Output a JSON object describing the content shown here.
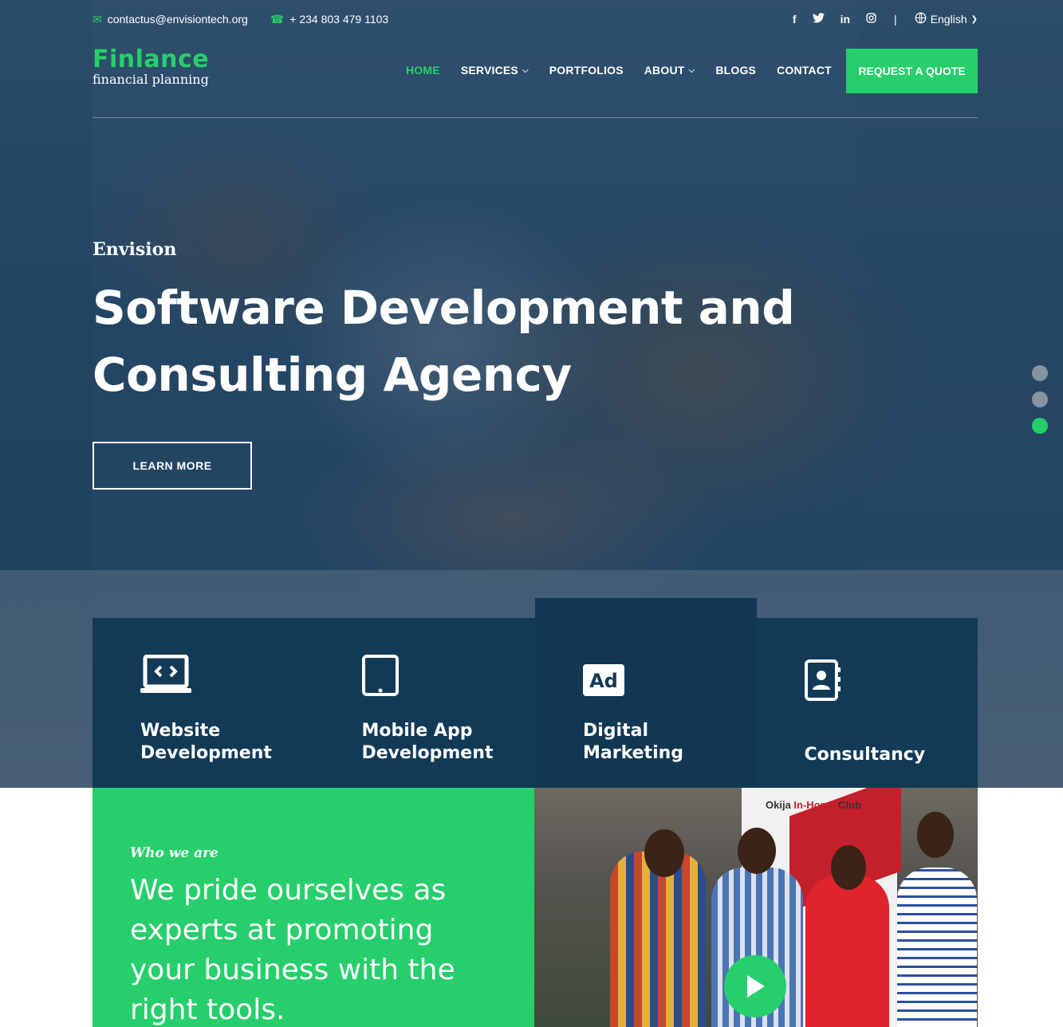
{
  "topbar": {
    "email": "contactus@envisiontech.org",
    "phone": "+ 234 803 479 1103",
    "social": [
      "facebook-icon",
      "twitter-icon",
      "linkedin-icon",
      "instagram-icon"
    ],
    "separator": "|",
    "language": "English"
  },
  "header": {
    "logo_name": "Finlance",
    "logo_tagline": "financial planning",
    "nav": [
      {
        "label": "HOME",
        "active": true
      },
      {
        "label": "SERVICES",
        "dropdown": true
      },
      {
        "label": "PORTFOLIOS"
      },
      {
        "label": "ABOUT",
        "dropdown": true
      },
      {
        "label": "BLOGS"
      },
      {
        "label": "CONTACT"
      }
    ],
    "cta": "REQUEST A QUOTE"
  },
  "hero": {
    "eyebrow": "Envision",
    "title_line1": "Software Development and",
    "title_line2": "Consulting Agency",
    "button": "LEARN MORE",
    "slides": 3,
    "active_slide": 3
  },
  "services": [
    {
      "title_line1": "Website",
      "title_line2": "Development",
      "icon": "laptop-code-icon"
    },
    {
      "title_line1": "Mobile App",
      "title_line2": "Development",
      "icon": "tablet-icon"
    },
    {
      "title_line1": "Digital",
      "title_line2": "Marketing",
      "icon": "ad-icon"
    },
    {
      "title_line1": "Consultancy",
      "title_line2": "",
      "icon": "contact-book-icon"
    }
  ],
  "about": {
    "eyebrow": "Who we are",
    "text": "We pride ourselves as experts at promoting your business with the right tools."
  },
  "photo": {
    "banner_text_1": "Okija",
    "banner_text_2": "In-Home",
    "banner_text_3": "Club"
  },
  "colors": {
    "accent": "#26cf6b",
    "navy": "#123a56"
  }
}
